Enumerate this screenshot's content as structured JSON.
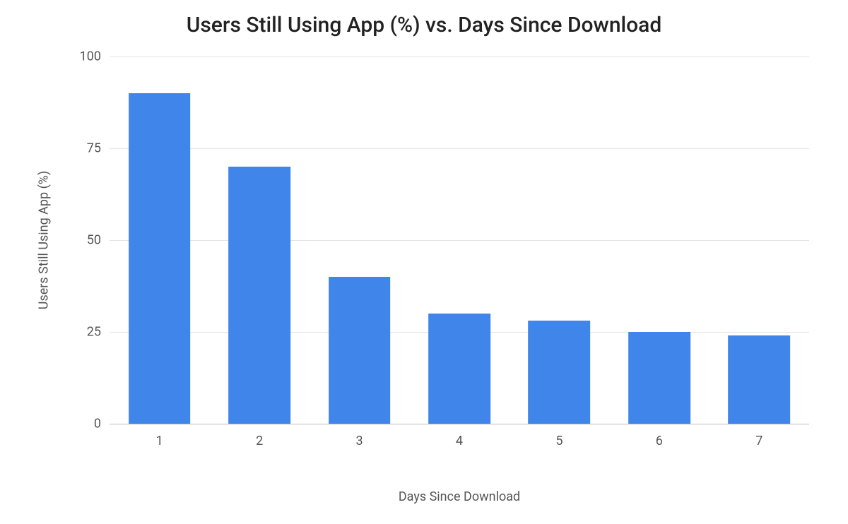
{
  "chart_data": {
    "type": "bar",
    "title": "Users Still Using App (%) vs. Days Since Download",
    "xlabel": "Days Since Download",
    "ylabel": "Users Still Using App (%)",
    "categories": [
      "1",
      "2",
      "3",
      "4",
      "5",
      "6",
      "7"
    ],
    "values": [
      90,
      70,
      40,
      30,
      28,
      25,
      24
    ],
    "ylim": [
      0,
      100
    ],
    "y_ticks": [
      0,
      25,
      50,
      75,
      100
    ],
    "bar_color": "#3f85ea",
    "grid": true
  }
}
